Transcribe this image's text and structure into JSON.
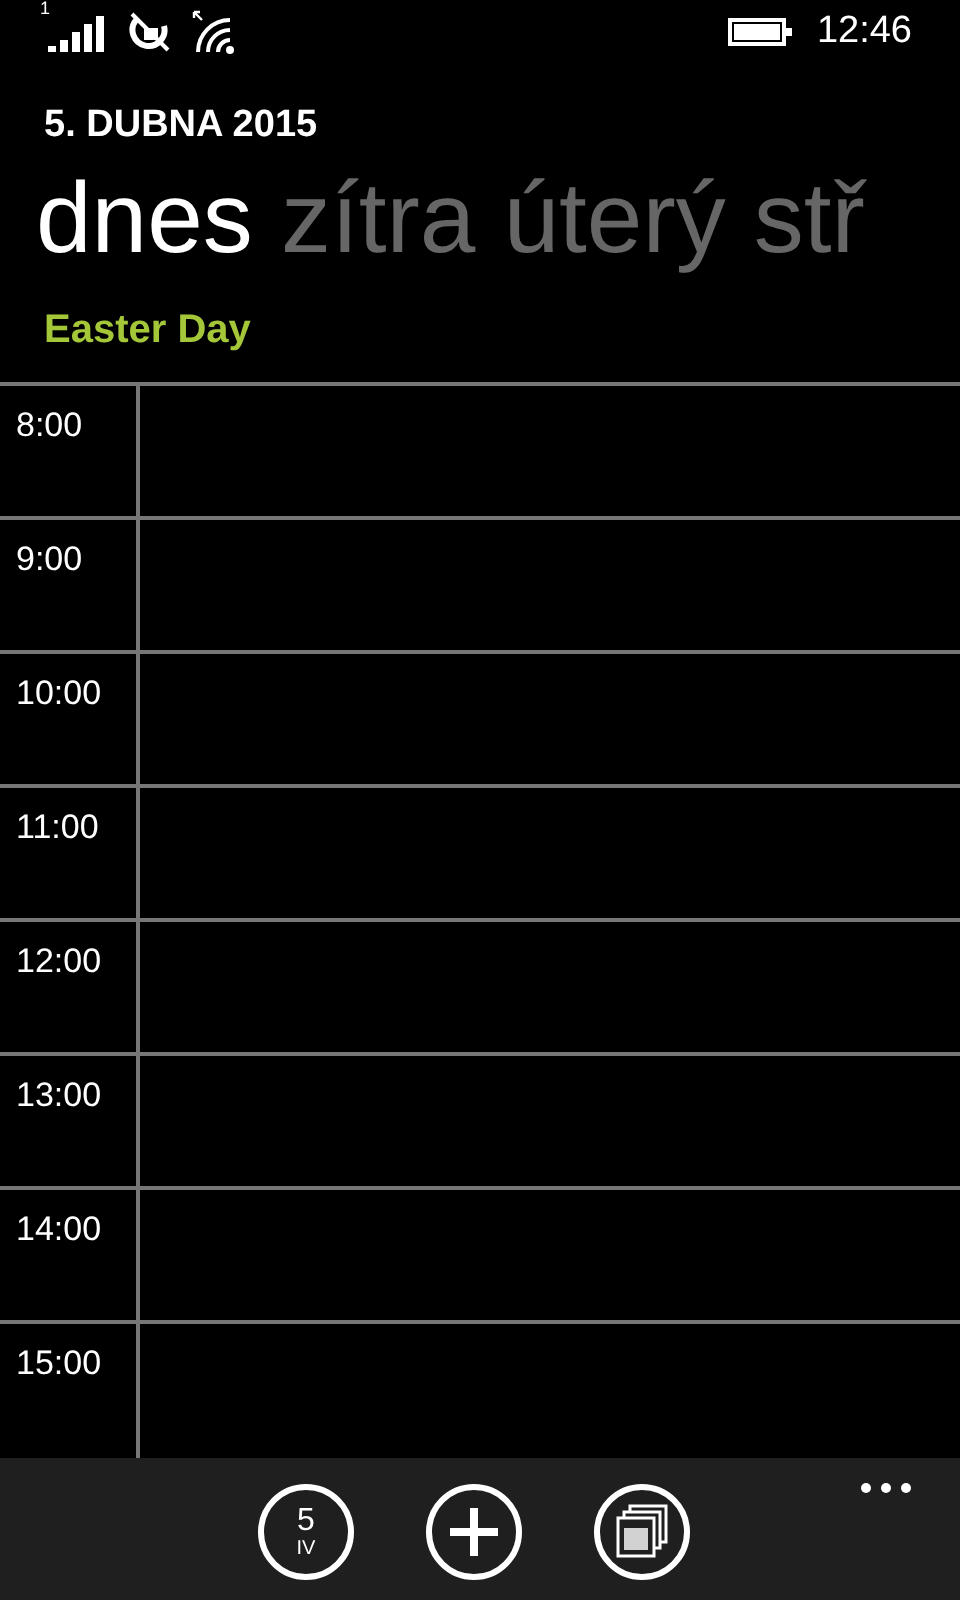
{
  "status_bar": {
    "signal_sim": "1",
    "time": "12:46"
  },
  "header": {
    "date": "5. DUBNA 2015"
  },
  "pivot": [
    {
      "label": "dnes",
      "selected": true
    },
    {
      "label": "zítra",
      "selected": false
    },
    {
      "label": "úterý",
      "selected": false
    },
    {
      "label": "stř",
      "selected": false
    }
  ],
  "all_day_event": {
    "title": "Easter Day",
    "color": "#a4c639"
  },
  "hours": [
    "8:00",
    "9:00",
    "10:00",
    "11:00",
    "12:00",
    "13:00",
    "14:00",
    "15:00"
  ],
  "app_bar": {
    "buttons": [
      {
        "kind": "today",
        "day": "5",
        "month": "IV"
      },
      {
        "kind": "add"
      },
      {
        "kind": "calendars"
      }
    ]
  }
}
